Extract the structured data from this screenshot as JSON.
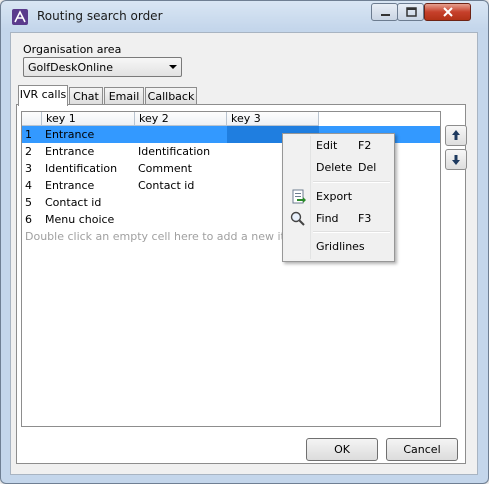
{
  "window": {
    "title": "Routing search order"
  },
  "org": {
    "label": "Organisation area",
    "value": "GolfDeskOnline"
  },
  "tabs": [
    {
      "label": "IVR calls",
      "active": true
    },
    {
      "label": "Chat",
      "active": false
    },
    {
      "label": "Email",
      "active": false
    },
    {
      "label": "Callback",
      "active": false
    }
  ],
  "grid": {
    "columns": [
      "key 1",
      "key 2",
      "key 3"
    ],
    "rows": [
      {
        "num": "1",
        "key1": "Entrance",
        "key2": "",
        "key3": ""
      },
      {
        "num": "2",
        "key1": "Entrance",
        "key2": "Identification",
        "key3": ""
      },
      {
        "num": "3",
        "key1": "Identification",
        "key2": "Comment",
        "key3": ""
      },
      {
        "num": "4",
        "key1": "Entrance",
        "key2": "Contact id",
        "key3": ""
      },
      {
        "num": "5",
        "key1": "Contact id",
        "key2": "",
        "key3": ""
      },
      {
        "num": "6",
        "key1": "Menu choice",
        "key2": "",
        "key3": ""
      }
    ],
    "hint": "Double click an empty cell here to add a new item."
  },
  "context_menu": {
    "items": [
      {
        "label": "Edit",
        "shortcut": "F2"
      },
      {
        "label": "Delete",
        "shortcut": "Del"
      },
      {
        "label": "Export",
        "shortcut": ""
      },
      {
        "label": "Find",
        "shortcut": "F3"
      },
      {
        "label": "Gridlines",
        "shortcut": ""
      }
    ]
  },
  "buttons": {
    "ok": "OK",
    "cancel": "Cancel"
  },
  "icons": {
    "move_up": "arrow-up-icon",
    "move_down": "arrow-down-icon",
    "export": "export-icon",
    "find": "magnifier-icon"
  },
  "colors": {
    "selection": "#3399ff",
    "selection_cell": "#1f7ee0",
    "hint": "#a0a0a0"
  }
}
